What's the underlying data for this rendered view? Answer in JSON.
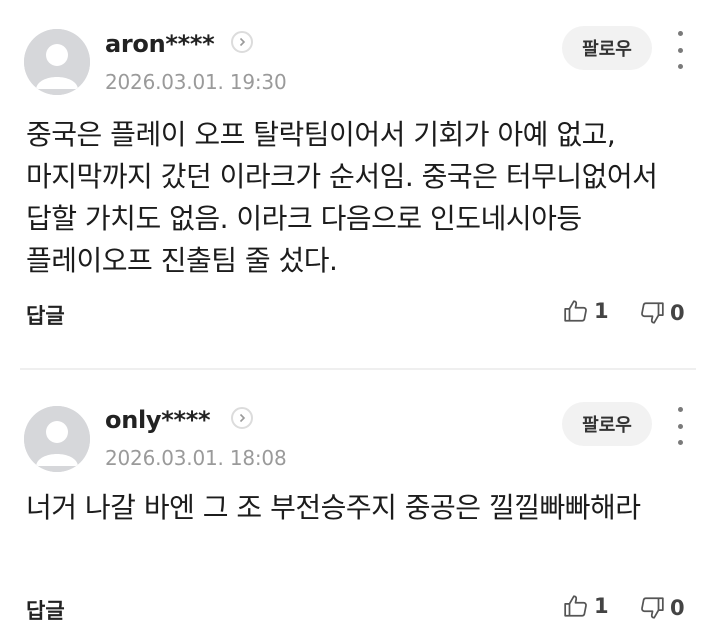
{
  "comments": [
    {
      "username": "aron****",
      "date": "2026.03.01. 19:30",
      "follow_label": "팔로우",
      "body": "중국은 플레이 오프 탈락팀이어서 기회가 아예 없고, 마지막까지 갔던 이라크가 순서임. 중국은 터무니없어서 답할 가치도 없음. 이라크 다음으로 인도네시아등 플레이오프 진출팀 줄 섰다.",
      "reply_label": "답글",
      "likes": "1",
      "dislikes": "0"
    },
    {
      "username": "only****",
      "date": "2026.03.01. 18:08",
      "follow_label": "팔로우",
      "body": "너거 나갈 바엔 그 조 부전승주지 중공은 낄낄빠빠해라",
      "reply_label": "답글",
      "likes": "1",
      "dislikes": "0"
    }
  ],
  "icons": {
    "avatar": "default-user-avatar",
    "chevron": "chevron-right-icon",
    "more": "kebab-menu-icon",
    "like": "thumbs-up-icon",
    "dislike": "thumbs-down-icon"
  },
  "colors": {
    "avatar_bg": "#d6d7da",
    "follow_bg": "#f2f2f2",
    "date": "#9a9a9a"
  }
}
